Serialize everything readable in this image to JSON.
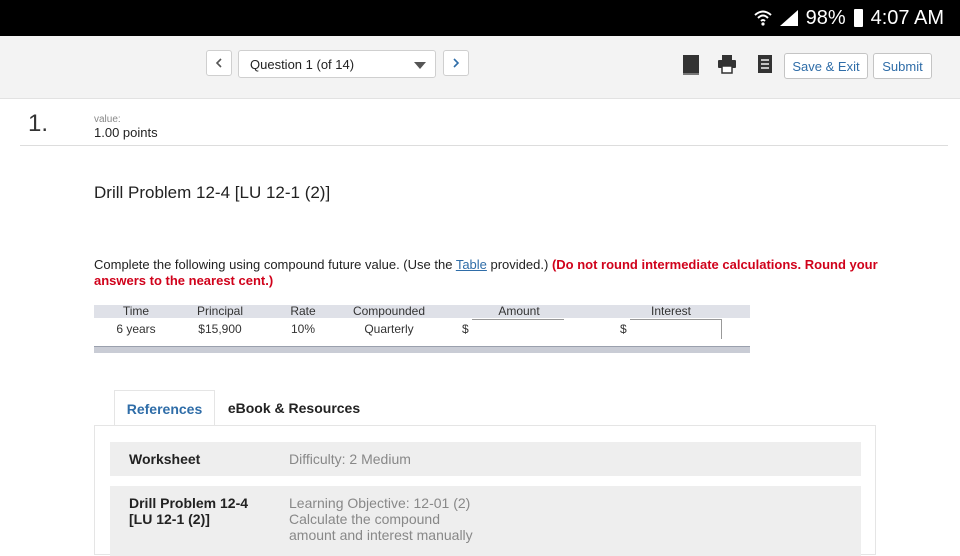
{
  "status_bar": {
    "battery": "98%",
    "time": "4:07 AM"
  },
  "toolbar": {
    "question_select": "Question 1 (of 14)",
    "save_exit": "Save & Exit",
    "submit": "Submit"
  },
  "question": {
    "number": "1.",
    "value_label": "value:",
    "points": "1.00 points",
    "title": "Drill Problem 12-4 [LU 12-1 (2)]",
    "instruction_pre": "Complete the following using compound future value. (Use the ",
    "instruction_link": "Table",
    "instruction_mid": " provided.) ",
    "instruction_bold": "(Do not round intermediate calculations. Round your answers to the nearest cent.)"
  },
  "table": {
    "headers": [
      "Time",
      "Principal",
      "Rate",
      "Compounded",
      "Amount",
      "Interest"
    ],
    "row": {
      "time": "6 years",
      "principal": "$15,900",
      "rate": "10%",
      "compounded": "Quarterly"
    },
    "currency": "$",
    "amount_value": "",
    "interest_value": ""
  },
  "tabs": {
    "references": "References",
    "ebook": "eBook & Resources"
  },
  "panel": {
    "worksheet_key": "Worksheet",
    "difficulty": "Difficulty: 2 Medium",
    "problem_key": "Drill Problem 12-4 [LU 12-1 (2)]",
    "learning_objective": "Learning Objective: 12-01 (2) Calculate the compound amount and interest manually"
  }
}
